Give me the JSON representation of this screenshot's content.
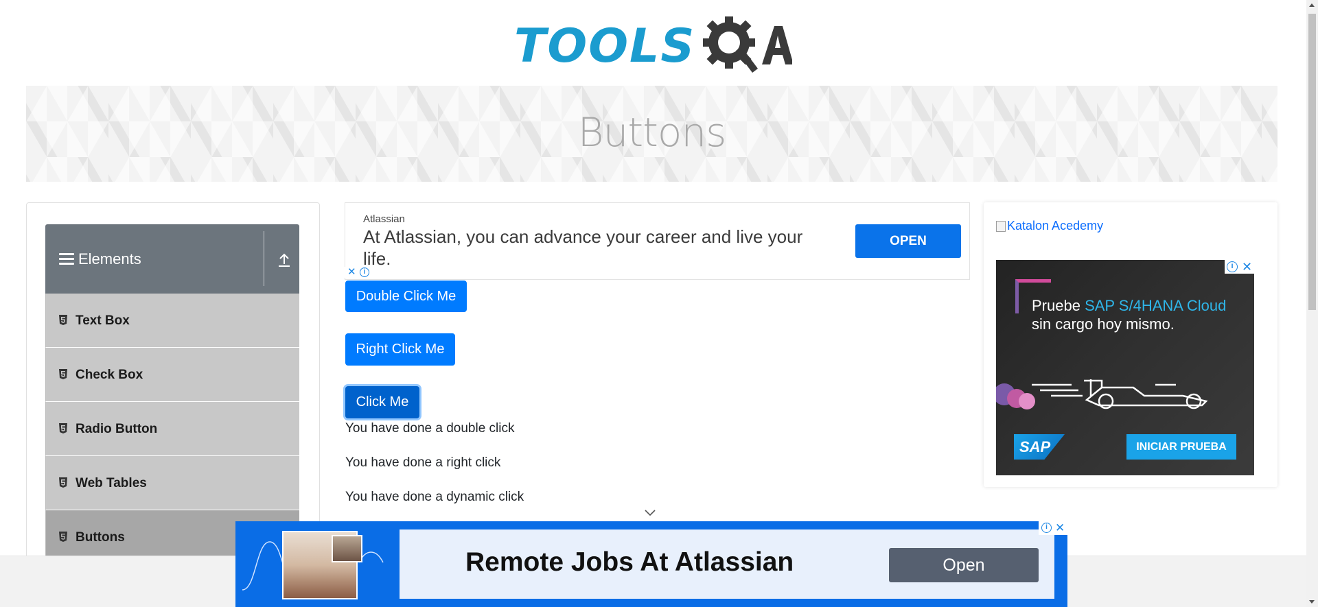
{
  "header": {
    "logo_text": "TOOLS",
    "logo_suffix": "QA"
  },
  "banner": {
    "title": "Buttons"
  },
  "sidebar": {
    "group_title": "Elements",
    "items": [
      {
        "label": "Text Box",
        "active": false
      },
      {
        "label": "Check Box",
        "active": false
      },
      {
        "label": "Radio Button",
        "active": false
      },
      {
        "label": "Web Tables",
        "active": false
      },
      {
        "label": "Buttons",
        "active": true
      }
    ]
  },
  "top_ad": {
    "brand": "Atlassian",
    "headline": "At Atlassian, you can advance your career and live your life.",
    "button": "OPEN"
  },
  "buttons": {
    "double_click": "Double Click Me",
    "right_click": "Right Click Me",
    "click": "Click Me"
  },
  "messages": {
    "double": "You have done a double click",
    "right": "You have done a right click",
    "dynamic": "You have done a dynamic click"
  },
  "right_ad": {
    "link_text": "Katalon Acedemy",
    "line1_prefix": "Pruebe ",
    "line1_highlight": "SAP S/4HANA Cloud",
    "line2": "sin cargo hoy mismo.",
    "logo": "SAP",
    "cta": "INICIAR PRUEBA"
  },
  "bottom_ad": {
    "headline": "Remote Jobs At Atlassian",
    "button": "Open"
  },
  "colors": {
    "primary": "#007bff",
    "primary_active": "#0062cc",
    "sidebar_header": "#6c757d",
    "sidebar_item": "#c8c8c8",
    "sidebar_active": "#a7a7a7",
    "logo_blue": "#1b9ccf",
    "ad_blue": "#0a6de6"
  },
  "icons": [
    "hamburger-icon",
    "collapse-up-icon",
    "html5-icon",
    "chevron-down-icon",
    "close-icon",
    "info-icon",
    "gear-magnifier-icon"
  ]
}
